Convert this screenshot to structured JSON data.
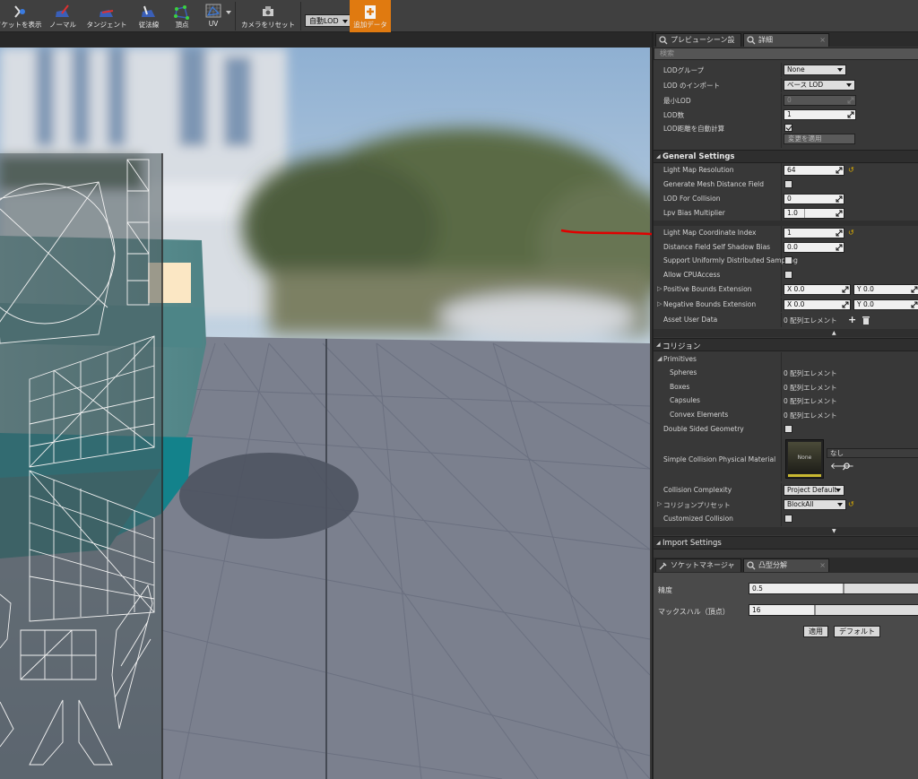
{
  "toolbar": {
    "items": [
      {
        "label": "ソケットを表示",
        "icon": "socket-icon"
      },
      {
        "label": "ノーマル",
        "icon": "normal-icon"
      },
      {
        "label": "タンジェント",
        "icon": "tangent-icon"
      },
      {
        "label": "従法線",
        "icon": "binormal-icon"
      },
      {
        "label": "頂点",
        "icon": "vertex-icon"
      },
      {
        "label": "UV",
        "icon": "uv-icon"
      },
      {
        "label": "カメラをリセット",
        "icon": "camera-reset-icon"
      },
      {
        "label": "追加データ",
        "icon": "additional-data-icon"
      }
    ],
    "lod_dropdown": "自動LOD",
    "accent_color": "#e07a10"
  },
  "panel": {
    "tabs": {
      "preview_scene": "プレビューシーン設",
      "details": "詳細",
      "socket_manager": "ソケットマネージャ",
      "convex_decomposition": "凸型分解"
    },
    "search_placeholder": "検索",
    "lod": {
      "group_label": "LODグループ",
      "group_value": "None",
      "import_label": "LOD のインポート",
      "import_value": "ベース LOD",
      "min_lod_label": "最小LOD",
      "min_lod_value": "0",
      "num_lods_label": "LOD数",
      "num_lods_value": "1",
      "auto_compute_label": "LOD距離を自動計算",
      "apply_button": "変更を適用"
    },
    "general": {
      "title": "General Settings",
      "lightmap_res_label": "Light Map Resolution",
      "lightmap_res_value": "64",
      "gen_distance_field_label": "Generate Mesh Distance Field",
      "lod_collision_label": "LOD For Collision",
      "lod_collision_value": "0",
      "lpv_bias_label": "Lpv Bias Multiplier",
      "lpv_bias_value": "1.0",
      "lightmap_coord_label": "Light Map Coordinate Index",
      "lightmap_coord_value": "1",
      "df_shadow_bias_label": "Distance Field Self Shadow Bias",
      "df_shadow_bias_value": "0.0",
      "uniform_sampling_label": "Support Uniformly Distributed Sampling",
      "cpu_access_label": "Allow CPUAccess",
      "pos_bounds_label": "Positive Bounds Extension",
      "neg_bounds_label": "Negative Bounds Extension",
      "x_prefix": "X",
      "y_prefix": "Y",
      "pos_x": "0.0",
      "pos_y": "0.0",
      "neg_x": "0.0",
      "neg_y": "0.0",
      "asset_user_data_label": "Asset User Data",
      "asset_user_data_value": "0 配列エレメント"
    },
    "collision": {
      "title": "コリジョン",
      "primitives_label": "Primitives",
      "spheres_label": "Spheres",
      "spheres_value": "0 配列エレメント",
      "boxes_label": "Boxes",
      "boxes_value": "0 配列エレメント",
      "capsules_label": "Capsules",
      "capsules_value": "0 配列エレメント",
      "convex_label": "Convex Elements",
      "convex_value": "0 配列エレメント",
      "double_sided_label": "Double Sided Geometry",
      "phys_material_label": "Simple Collision Physical Material",
      "phys_material_thumb": "None",
      "phys_material_value": "なし",
      "complexity_label": "Collision Complexity",
      "complexity_value": "Project Default",
      "preset_label": "コリジョンプリセット",
      "preset_value": "BlockAll",
      "customized_label": "Customized Collision"
    },
    "import": {
      "title": "Import Settings"
    }
  },
  "convex": {
    "accuracy_label": "精度",
    "accuracy_value": "0.5",
    "accuracy_fraction": 0.5,
    "max_hull_label": "マックスハル（頂点）",
    "max_hull_value": "16",
    "max_hull_fraction": 0.16,
    "apply_button": "適用",
    "default_button": "デフォルト"
  }
}
